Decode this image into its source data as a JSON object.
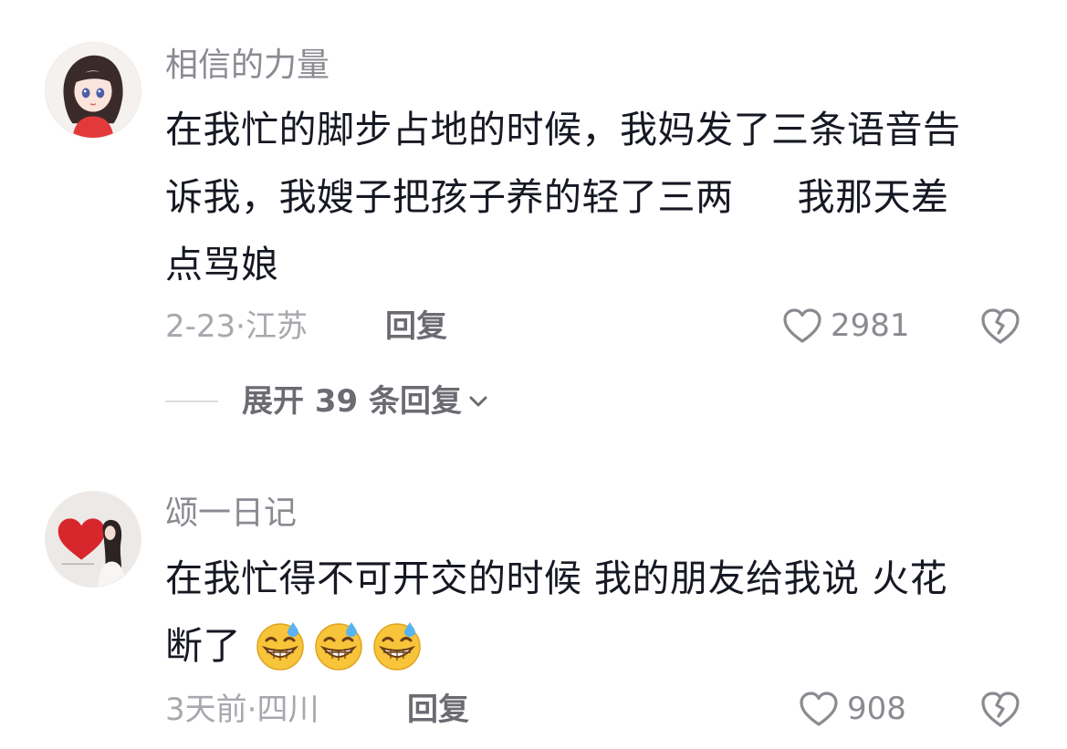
{
  "comments": [
    {
      "username": "相信的力量",
      "text_lines": [
        "在我忙的脚步占地的时候，我妈发了三条语音告",
        "诉我，我嫂子把孩子养的轻了三两",
        "我那天差",
        "点骂娘"
      ],
      "date": "2-23",
      "location": "江苏",
      "reply_label": "回复",
      "likes": "2981",
      "expand_replies_label": "展开 39 条回复"
    },
    {
      "username": "颂一日记",
      "text_line1": "在我忙得不可开交的时候 我的朋友给我说 火花",
      "text_line2": "断了",
      "emojis": [
        "grinning-sweat-emoji",
        "grinning-sweat-emoji",
        "grinning-sweat-emoji"
      ],
      "date": "3天前",
      "location": "四川",
      "reply_label": "回复",
      "likes": "908"
    }
  ],
  "separator": "·",
  "icons": {
    "like": "heart-outline-icon",
    "dislike": "broken-heart-icon",
    "expand": "chevron-down-icon"
  },
  "colors": {
    "username": "#8a8b91",
    "body": "#161823",
    "meta": "#a7a8ad",
    "action": "#6b6c72",
    "emoji": "#f7c43a"
  }
}
